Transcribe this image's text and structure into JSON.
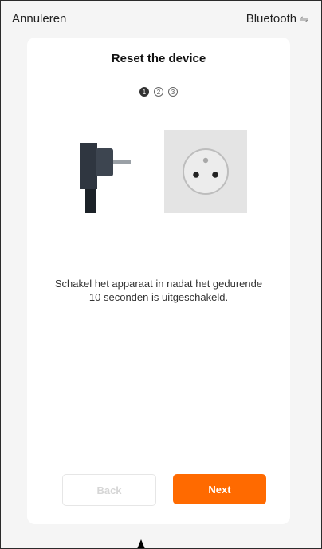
{
  "header": {
    "cancel_label": "Annuleren",
    "bluetooth_label": "Bluetooth",
    "bluetooth_icon": "⇋"
  },
  "card": {
    "title": "Reset the device",
    "steps": [
      "1",
      "2",
      "3"
    ],
    "active_step": 1,
    "instruction_lines": [
      "Schakel het apparaat in nadat het gedurende",
      "10 seconden is uitgeschakeld."
    ]
  },
  "actions": {
    "back_label": "Back",
    "next_label": "Next"
  },
  "colors": {
    "accent": "#ff6a00",
    "disabled_text": "#d6d6d6"
  }
}
